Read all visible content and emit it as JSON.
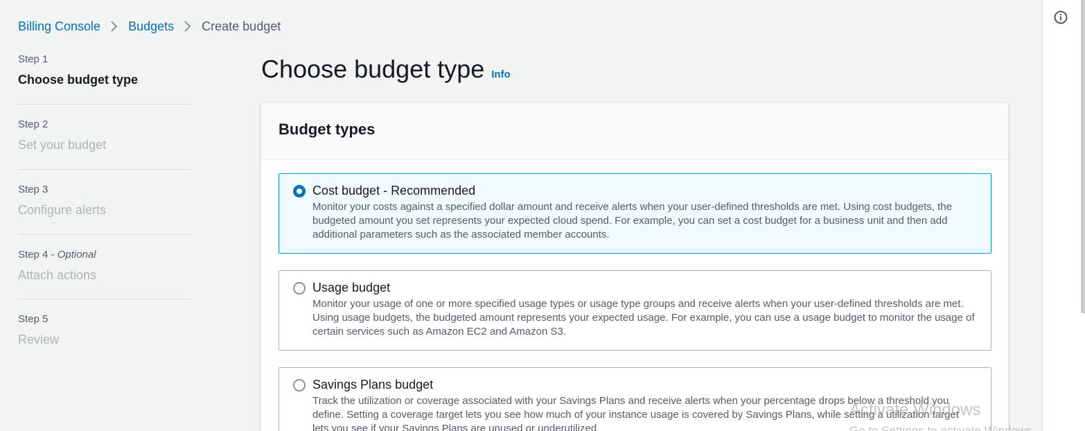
{
  "breadcrumb": {
    "items": [
      {
        "label": "Billing Console"
      },
      {
        "label": "Budgets"
      }
    ],
    "current": "Create budget"
  },
  "steps": [
    {
      "number": "Step 1",
      "title": "Choose budget type",
      "active": true
    },
    {
      "number": "Step 2",
      "title": "Set your budget"
    },
    {
      "number": "Step 3",
      "title": "Configure alerts"
    },
    {
      "number": "Step 4 - ",
      "optional": "Optional",
      "title": "Attach actions"
    },
    {
      "number": "Step 5",
      "title": "Review"
    }
  ],
  "page": {
    "title": "Choose budget type",
    "info_link": "Info"
  },
  "budget_types": {
    "header": "Budget types",
    "options": [
      {
        "title": "Cost budget - Recommended",
        "description": "Monitor your costs against a specified dollar amount and receive alerts when your user-defined thresholds are met. Using cost budgets, the budgeted amount you set represents your expected cloud spend. For example, you can set a cost budget for a business unit and then add additional parameters such as the associated member accounts.",
        "selected": true
      },
      {
        "title": "Usage budget",
        "description": "Monitor your usage of one or more specified usage types or usage type groups and receive alerts when your user-defined thresholds are met. Using usage budgets, the budgeted amount represents your expected usage. For example, you can use a usage budget to monitor the usage of certain services such as Amazon EC2 and Amazon S3.",
        "selected": false
      },
      {
        "title": "Savings Plans budget",
        "description": "Track the utilization or coverage associated with your Savings Plans and receive alerts when your percentage drops below a threshold you define. Setting a coverage target lets you see how much of your instance usage is covered by Savings Plans, while setting a utilization target lets you see if your Savings Plans are unused or underutilized.",
        "selected": false
      }
    ]
  },
  "watermark": {
    "line1": "Activate Windows",
    "line2": "Go to Settings to activate Windows."
  },
  "colors": {
    "link": "#0073bb",
    "selected_border": "#00a1c9",
    "selected_bg": "#f1faff",
    "page_bg": "#f2f3f3"
  },
  "icons": {
    "tools": "info-circle-icon",
    "breadcrumb_separator": "chevron-right-icon"
  }
}
